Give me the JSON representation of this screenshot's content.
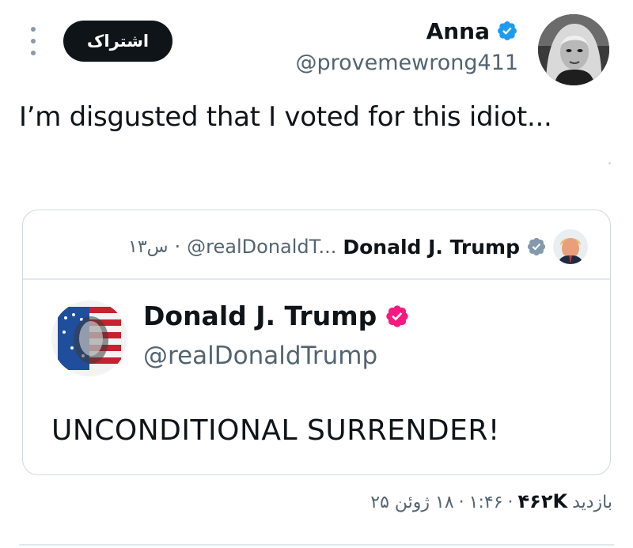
{
  "header": {
    "more_icon": "more-vertical-icon",
    "subscribe_label": "اشتراک",
    "author": {
      "name": "Anna",
      "handle": "@provemewrong411",
      "verified_icon": "verified-badge-icon",
      "verified_color": "#1d9bf0"
    }
  },
  "tweet": {
    "text": "I’m disgusted that I voted for this idiot..."
  },
  "quote": {
    "author_name": "Donald J. Trump",
    "author_handle": "@realDonaldT...",
    "separator": "·",
    "time": "۱۳س",
    "verified_icon": "verified-badge-icon",
    "verified_color": "#829aab",
    "inner_post": {
      "author_name": "Donald J. Trump",
      "author_handle": "@realDonaldTrump",
      "verified_icon": "verified-badge-icon",
      "verified_color": "#f91880",
      "text": "UNCONDITIONAL SURRENDER!"
    }
  },
  "meta": {
    "views_label": "بازدید",
    "views_count": "۴۶۲K",
    "separator": "·",
    "time": "۱:۴۶",
    "date": "۱۸ ژوئن ۲۵"
  }
}
